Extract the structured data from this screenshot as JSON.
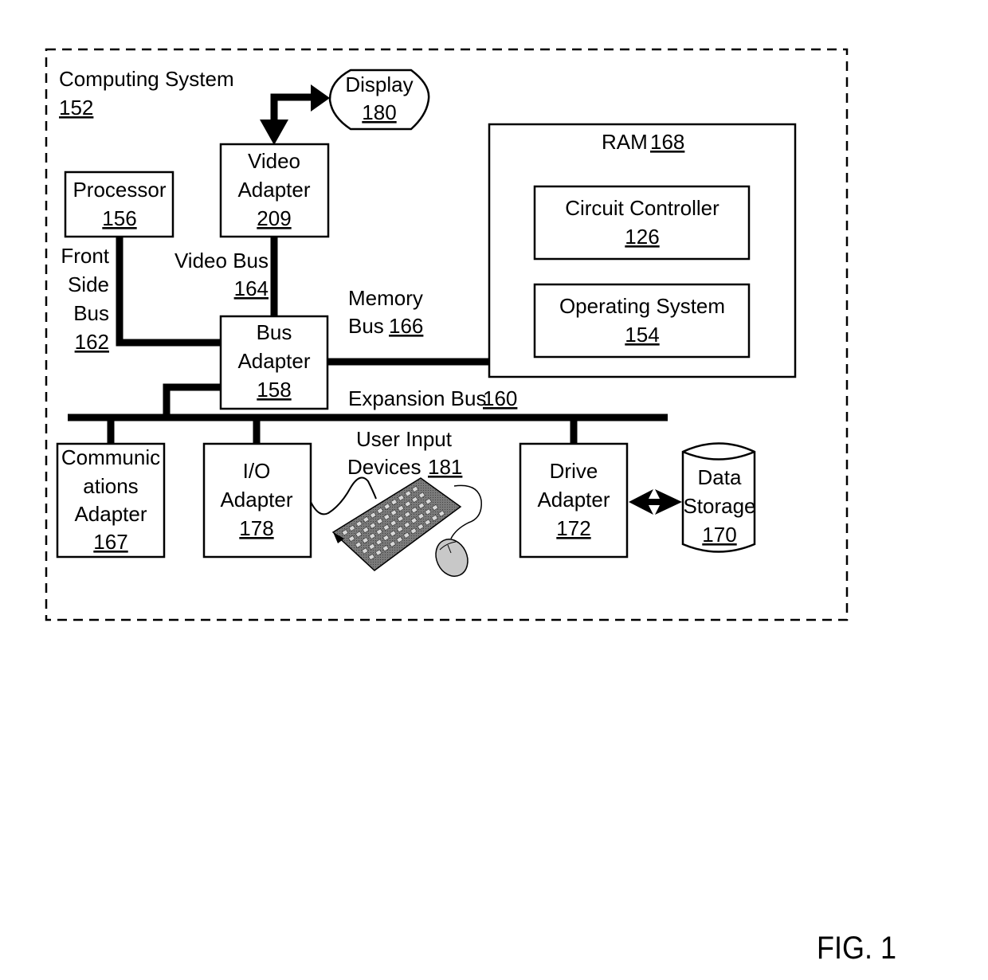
{
  "figure": {
    "label": "FIG. 1",
    "system": {
      "name": "Computing System",
      "ref": "152"
    },
    "display": {
      "name": "Display",
      "ref": "180"
    },
    "video_adapter": {
      "line1": "Video",
      "line2": "Adapter",
      "ref": "209"
    },
    "processor": {
      "name": "Processor",
      "ref": "156"
    },
    "front_side_bus": {
      "line1": "Front",
      "line2": "Side",
      "line3": "Bus",
      "ref": "162"
    },
    "video_bus": {
      "name": "Video Bus",
      "ref": "164"
    },
    "bus_adapter": {
      "line1": "Bus",
      "line2": "Adapter",
      "ref": "158"
    },
    "memory_bus": {
      "line1": "Memory",
      "line2": "Bus",
      "ref": "166"
    },
    "ram": {
      "name": "RAM",
      "ref": "168"
    },
    "circuit_controller": {
      "name": "Circuit Controller",
      "ref": "126"
    },
    "operating_system": {
      "name": "Operating System",
      "ref": "154"
    },
    "expansion_bus": {
      "name": "Expansion Bus",
      "ref": "160"
    },
    "comm_adapter": {
      "line1": "Communic",
      "line2": "ations",
      "line3": "Adapter",
      "ref": "167"
    },
    "io_adapter": {
      "line1": "I/O",
      "line2": "Adapter",
      "ref": "178"
    },
    "user_input": {
      "line1": "User Input",
      "line2": "Devices",
      "ref": "181"
    },
    "drive_adapter": {
      "line1": "Drive",
      "line2": "Adapter",
      "ref": "172"
    },
    "data_storage": {
      "line1": "Data",
      "line2": "Storage",
      "ref": "170"
    }
  }
}
